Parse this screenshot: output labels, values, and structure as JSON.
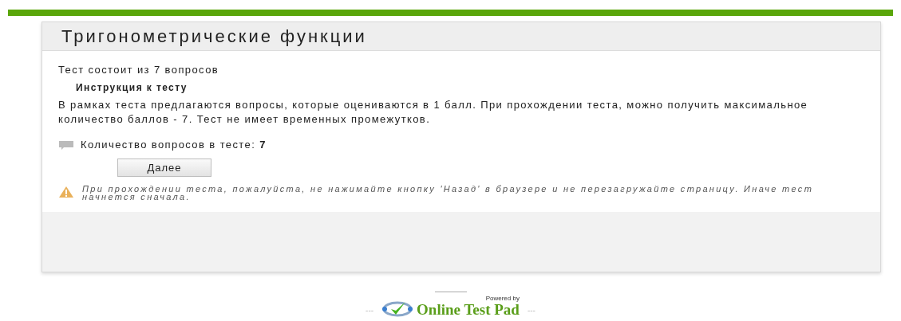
{
  "title": "Тригонометрические функции",
  "intro": "Тест состоит из 7 вопросов",
  "instruction_heading": "Инструкция к тесту",
  "instruction_text": "В рамках теста предлагаются вопросы, которые оцениваются в 1 балл. При прохождении теста, можно получить максимальное количество баллов - 7. Тест не имеет временных промежутков.",
  "question_count": "Количество вопросов в тесте: **7**",
  "next_button": "Далее",
  "warning": "При прохождении теста, пожалуйста, не нажимайте кнопку 'Назад' в браузере и не перезагружайте страницу. Иначе тест начнется сначала.",
  "footer": {
    "left_dashes": "---",
    "powered_by": "Powered by",
    "brand": "Online Test Pad",
    "right_dashes": "---"
  }
}
